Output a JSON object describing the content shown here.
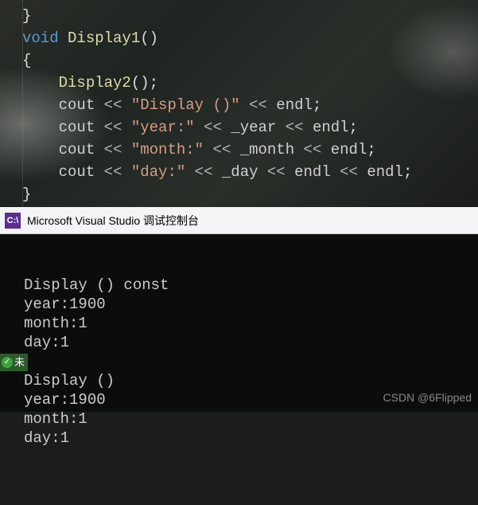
{
  "editor": {
    "lines": [
      {
        "indent": 0,
        "tokens": [
          {
            "t": "brace",
            "v": "}"
          }
        ]
      },
      {
        "indent": 0,
        "tokens": [
          {
            "t": "type",
            "v": "void"
          },
          {
            "t": "plain",
            "v": " "
          },
          {
            "t": "func",
            "v": "Display1"
          },
          {
            "t": "plain",
            "v": "()"
          }
        ]
      },
      {
        "indent": 0,
        "tokens": [
          {
            "t": "brace",
            "v": "{"
          }
        ]
      },
      {
        "indent": 1,
        "tokens": [
          {
            "t": "func",
            "v": "Display2"
          },
          {
            "t": "plain",
            "v": "();"
          }
        ]
      },
      {
        "indent": 1,
        "tokens": [
          {
            "t": "var",
            "v": "cout"
          },
          {
            "t": "plain",
            "v": " "
          },
          {
            "t": "op",
            "v": "<<"
          },
          {
            "t": "plain",
            "v": " "
          },
          {
            "t": "str",
            "v": "\"Display ()\""
          },
          {
            "t": "plain",
            "v": " "
          },
          {
            "t": "op",
            "v": "<<"
          },
          {
            "t": "plain",
            "v": " "
          },
          {
            "t": "var",
            "v": "endl"
          },
          {
            "t": "plain",
            "v": ";"
          }
        ]
      },
      {
        "indent": 1,
        "tokens": [
          {
            "t": "var",
            "v": "cout"
          },
          {
            "t": "plain",
            "v": " "
          },
          {
            "t": "op",
            "v": "<<"
          },
          {
            "t": "plain",
            "v": " "
          },
          {
            "t": "str",
            "v": "\"year:\""
          },
          {
            "t": "plain",
            "v": " "
          },
          {
            "t": "op",
            "v": "<<"
          },
          {
            "t": "plain",
            "v": " "
          },
          {
            "t": "var",
            "v": "_year"
          },
          {
            "t": "plain",
            "v": " "
          },
          {
            "t": "op",
            "v": "<<"
          },
          {
            "t": "plain",
            "v": " "
          },
          {
            "t": "var",
            "v": "endl"
          },
          {
            "t": "plain",
            "v": ";"
          }
        ]
      },
      {
        "indent": 1,
        "tokens": [
          {
            "t": "var",
            "v": "cout"
          },
          {
            "t": "plain",
            "v": " "
          },
          {
            "t": "op",
            "v": "<<"
          },
          {
            "t": "plain",
            "v": " "
          },
          {
            "t": "str",
            "v": "\"month:\""
          },
          {
            "t": "plain",
            "v": " "
          },
          {
            "t": "op",
            "v": "<<"
          },
          {
            "t": "plain",
            "v": " "
          },
          {
            "t": "var",
            "v": "_month"
          },
          {
            "t": "plain",
            "v": " "
          },
          {
            "t": "op",
            "v": "<<"
          },
          {
            "t": "plain",
            "v": " "
          },
          {
            "t": "var",
            "v": "endl"
          },
          {
            "t": "plain",
            "v": ";"
          }
        ]
      },
      {
        "indent": 1,
        "tokens": [
          {
            "t": "var",
            "v": "cout"
          },
          {
            "t": "plain",
            "v": " "
          },
          {
            "t": "op",
            "v": "<<"
          },
          {
            "t": "plain",
            "v": " "
          },
          {
            "t": "str",
            "v": "\"day:\""
          },
          {
            "t": "plain",
            "v": " "
          },
          {
            "t": "op",
            "v": "<<"
          },
          {
            "t": "plain",
            "v": " "
          },
          {
            "t": "var",
            "v": "_day"
          },
          {
            "t": "plain",
            "v": " "
          },
          {
            "t": "op",
            "v": "<<"
          },
          {
            "t": "plain",
            "v": " "
          },
          {
            "t": "var",
            "v": "endl"
          },
          {
            "t": "plain",
            "v": " "
          },
          {
            "t": "op",
            "v": "<<"
          },
          {
            "t": "plain",
            "v": " "
          },
          {
            "t": "var",
            "v": "endl"
          },
          {
            "t": "plain",
            "v": ";"
          }
        ]
      },
      {
        "indent": 0,
        "tokens": [
          {
            "t": "brace",
            "v": "}"
          }
        ]
      }
    ]
  },
  "titlebar": {
    "icon_label": "C:\\",
    "title": "Microsoft Visual Studio 调试控制台"
  },
  "console": {
    "lines": [
      "Display () const",
      "year:1900",
      "month:1",
      "day:1",
      "",
      "Display ()",
      "year:1900",
      "month:1",
      "day:1"
    ]
  },
  "badge": {
    "check": "✓",
    "text": "未"
  },
  "watermark": "CSDN @6Flipped"
}
